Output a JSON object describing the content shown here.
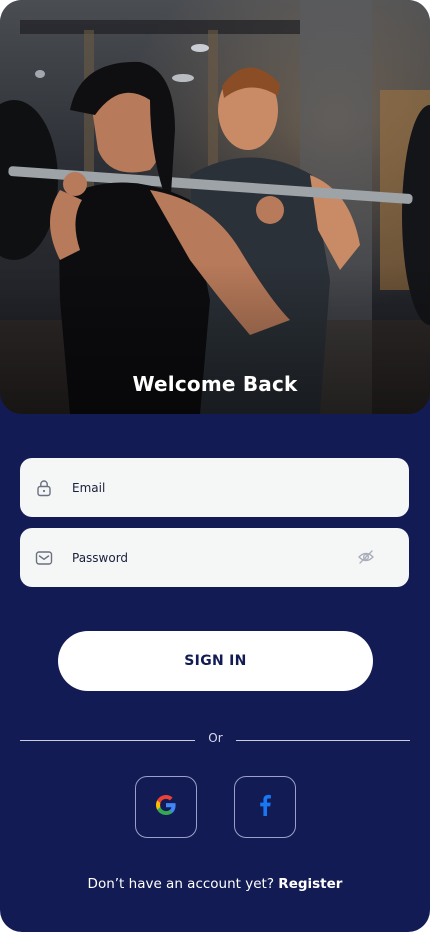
{
  "hero": {
    "title": "Welcome Back"
  },
  "form": {
    "email": {
      "placeholder": "Email",
      "value": "",
      "icon": "lock-icon"
    },
    "password": {
      "placeholder": "Password",
      "value": "",
      "icon": "mail-icon",
      "toggle_icon": "eye-off-icon"
    },
    "submit_label": "SIGN IN"
  },
  "divider": {
    "label": "Or"
  },
  "social": {
    "google_icon": "google-icon",
    "facebook_icon": "facebook-icon"
  },
  "footer": {
    "prompt": "Don’t have an account yet?",
    "link": "Register"
  },
  "colors": {
    "background": "#131b54",
    "field": "#f5f7f7",
    "button": "#ffffff",
    "button_text": "#131b54",
    "facebook": "#1877f2"
  }
}
